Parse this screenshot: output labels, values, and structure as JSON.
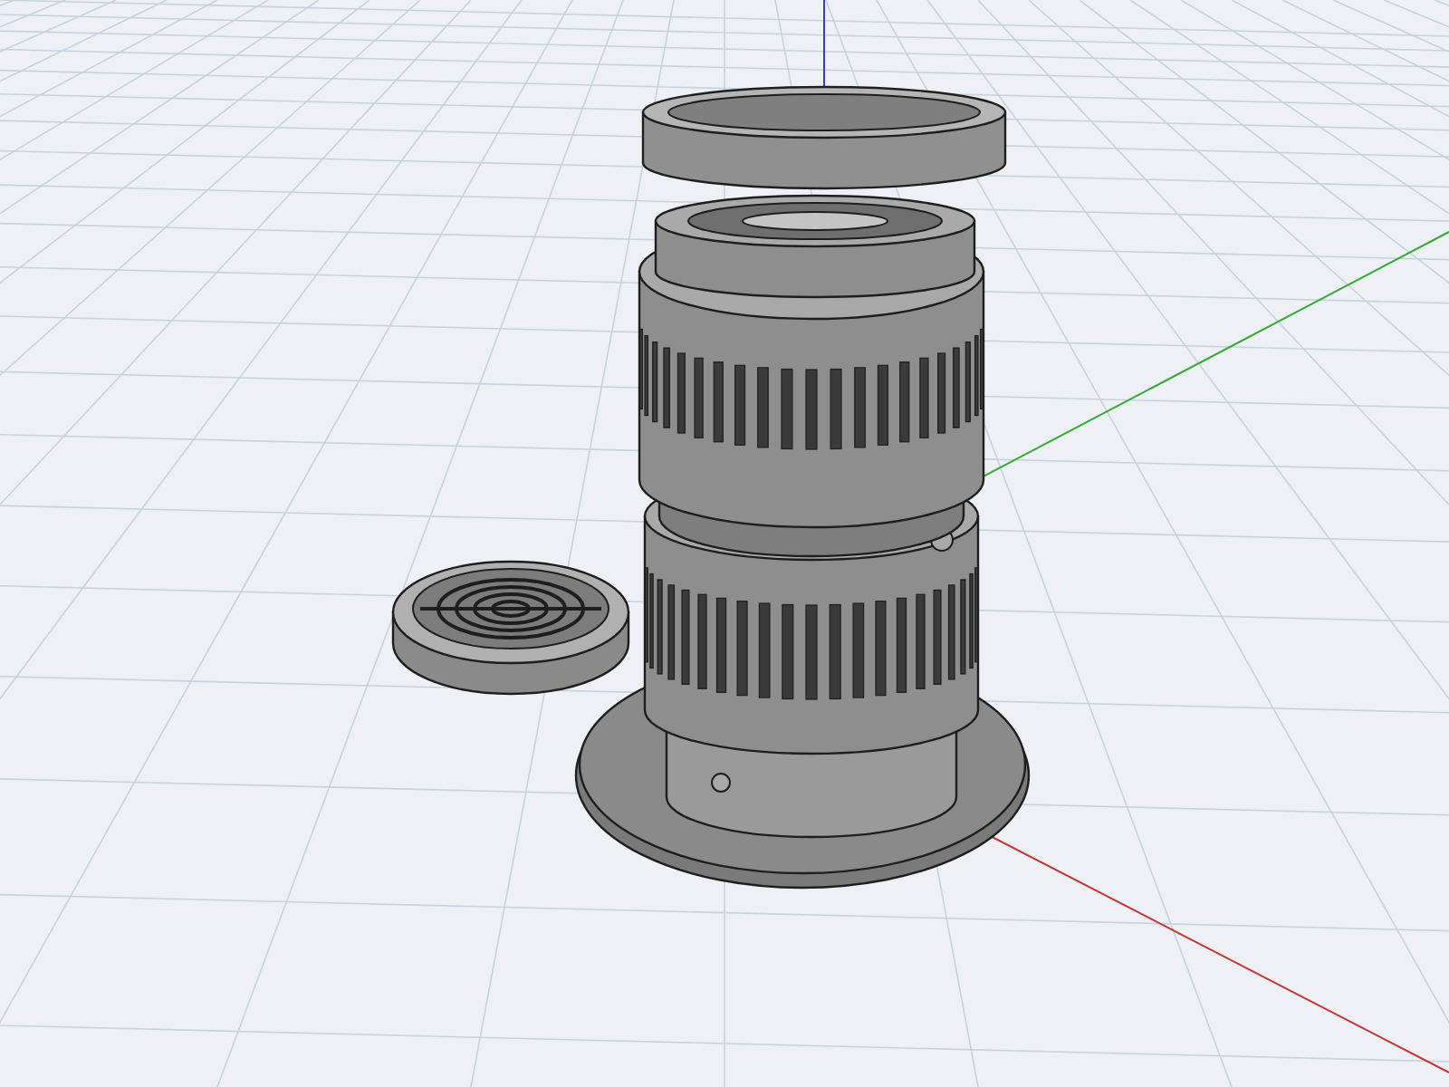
{
  "viewport": {
    "parts": [
      {
        "kind": "plate"
      },
      {
        "kind": "cap"
      },
      {
        "kind": "tower"
      },
      {
        "kind": "lid"
      }
    ]
  }
}
